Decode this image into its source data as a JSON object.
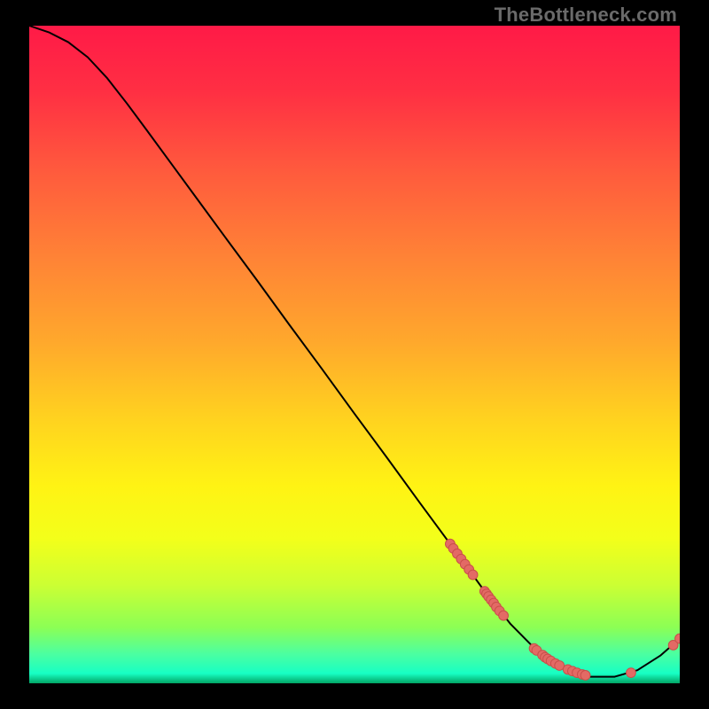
{
  "watermark": "TheBottleneck.com",
  "chart_data": {
    "type": "line",
    "title": "",
    "xlabel": "",
    "ylabel": "",
    "xlim": [
      0,
      100
    ],
    "ylim": [
      0,
      100
    ],
    "grid": false,
    "curve": [
      {
        "x": 0.0,
        "y": 100.0
      },
      {
        "x": 3.0,
        "y": 99.0
      },
      {
        "x": 6.0,
        "y": 97.5
      },
      {
        "x": 9.0,
        "y": 95.2
      },
      {
        "x": 12.0,
        "y": 92.0
      },
      {
        "x": 15.0,
        "y": 88.2
      },
      {
        "x": 18.0,
        "y": 84.2
      },
      {
        "x": 22.0,
        "y": 78.8
      },
      {
        "x": 26.0,
        "y": 73.4
      },
      {
        "x": 30.0,
        "y": 68.0
      },
      {
        "x": 35.0,
        "y": 61.3
      },
      {
        "x": 40.0,
        "y": 54.5
      },
      {
        "x": 45.0,
        "y": 47.8
      },
      {
        "x": 50.0,
        "y": 41.0
      },
      {
        "x": 55.0,
        "y": 34.3
      },
      {
        "x": 60.0,
        "y": 27.5
      },
      {
        "x": 65.0,
        "y": 20.8
      },
      {
        "x": 70.0,
        "y": 14.0
      },
      {
        "x": 74.0,
        "y": 9.0
      },
      {
        "x": 78.0,
        "y": 5.0
      },
      {
        "x": 82.0,
        "y": 2.3
      },
      {
        "x": 86.0,
        "y": 1.0
      },
      {
        "x": 90.0,
        "y": 1.0
      },
      {
        "x": 93.5,
        "y": 2.0
      },
      {
        "x": 97.0,
        "y": 4.2
      },
      {
        "x": 100.0,
        "y": 6.8
      }
    ],
    "dot_clusters": [
      {
        "x": 64.7,
        "y": 21.2
      },
      {
        "x": 65.2,
        "y": 20.5
      },
      {
        "x": 65.8,
        "y": 19.7
      },
      {
        "x": 66.4,
        "y": 18.9
      },
      {
        "x": 67.0,
        "y": 18.1
      },
      {
        "x": 67.6,
        "y": 17.3
      },
      {
        "x": 68.2,
        "y": 16.5
      },
      {
        "x": 70.0,
        "y": 14.0
      },
      {
        "x": 70.3,
        "y": 13.6
      },
      {
        "x": 70.6,
        "y": 13.2
      },
      {
        "x": 71.0,
        "y": 12.7
      },
      {
        "x": 71.4,
        "y": 12.2
      },
      {
        "x": 71.8,
        "y": 11.6
      },
      {
        "x": 72.3,
        "y": 11.0
      },
      {
        "x": 72.9,
        "y": 10.3
      },
      {
        "x": 77.6,
        "y": 5.3
      },
      {
        "x": 78.0,
        "y": 5.0
      },
      {
        "x": 78.9,
        "y": 4.3
      },
      {
        "x": 79.3,
        "y": 3.95
      },
      {
        "x": 79.7,
        "y": 3.7
      },
      {
        "x": 80.2,
        "y": 3.4
      },
      {
        "x": 80.9,
        "y": 3.0
      },
      {
        "x": 81.5,
        "y": 2.7
      },
      {
        "x": 82.8,
        "y": 2.1
      },
      {
        "x": 83.5,
        "y": 1.85
      },
      {
        "x": 84.2,
        "y": 1.6
      },
      {
        "x": 85.0,
        "y": 1.35
      },
      {
        "x": 85.5,
        "y": 1.22
      },
      {
        "x": 92.5,
        "y": 1.6
      },
      {
        "x": 99.0,
        "y": 5.8
      },
      {
        "x": 100.0,
        "y": 6.8
      }
    ],
    "colors": {
      "gradient_stops": [
        {
          "offset": 0.0,
          "color": "#ff1a47"
        },
        {
          "offset": 0.1,
          "color": "#ff2f43"
        },
        {
          "offset": 0.22,
          "color": "#ff5a3d"
        },
        {
          "offset": 0.35,
          "color": "#ff8236"
        },
        {
          "offset": 0.48,
          "color": "#ffa82c"
        },
        {
          "offset": 0.6,
          "color": "#ffd31f"
        },
        {
          "offset": 0.7,
          "color": "#fff314"
        },
        {
          "offset": 0.78,
          "color": "#f3ff1a"
        },
        {
          "offset": 0.85,
          "color": "#ccff33"
        },
        {
          "offset": 0.915,
          "color": "#8cff55"
        },
        {
          "offset": 0.955,
          "color": "#4cffa0"
        },
        {
          "offset": 0.985,
          "color": "#17ffc4"
        },
        {
          "offset": 1.0,
          "color": "#02a565"
        }
      ],
      "curve": "#000000",
      "dot_fill": "#e36a65",
      "dot_stroke": "#c94f4a"
    }
  }
}
